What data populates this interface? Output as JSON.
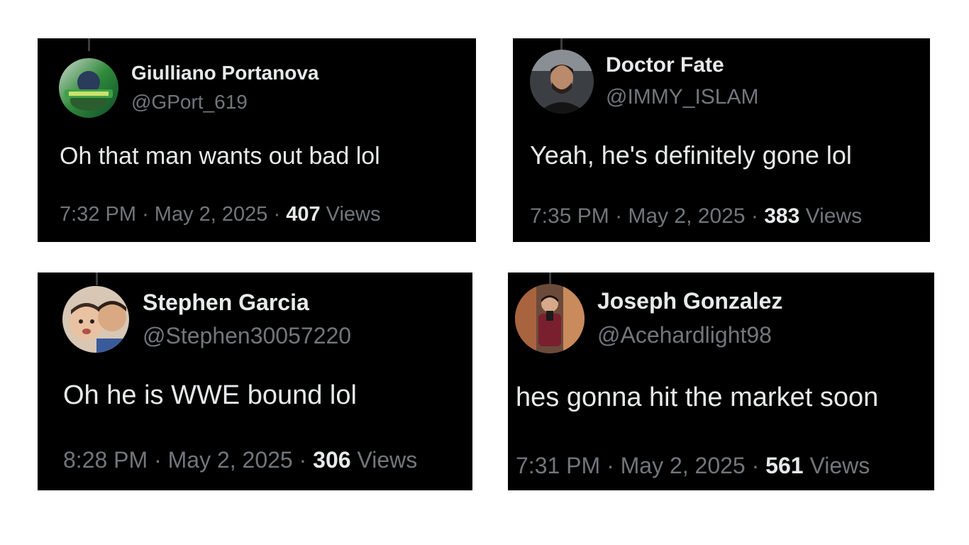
{
  "tweets": [
    {
      "name": "Giulliano Portanova",
      "handle": "@GPort_619",
      "text": "Oh that man wants out bad lol",
      "time": "7:32 PM",
      "date": "May 2, 2025",
      "views": "407",
      "views_label": "Views",
      "avatar_icon": "profile-photo-icon"
    },
    {
      "name": "Doctor Fate",
      "handle": "@IMMY_ISLAM",
      "text": "Yeah, he's definitely gone lol",
      "time": "7:35 PM",
      "date": "May 2, 2025",
      "views": "383",
      "views_label": "Views",
      "avatar_icon": "profile-photo-icon"
    },
    {
      "name": "Stephen Garcia",
      "handle": "@Stephen30057220",
      "text": "Oh he is WWE bound lol",
      "time": "8:28 PM",
      "date": "May 2, 2025",
      "views": "306",
      "views_label": "Views",
      "avatar_icon": "profile-photo-icon"
    },
    {
      "name": "Joseph Gonzalez",
      "handle": "@Acehardlight98",
      "text": "hes gonna hit the market soon",
      "time": "7:31 PM",
      "date": "May 2, 2025",
      "views": "561",
      "views_label": "Views",
      "avatar_icon": "profile-photo-icon"
    }
  ],
  "separator": "·",
  "colors": {
    "card_background": "#000000",
    "primary_text": "#e7e9ea",
    "secondary_text": "#71767b",
    "page_background": "#ffffff"
  }
}
